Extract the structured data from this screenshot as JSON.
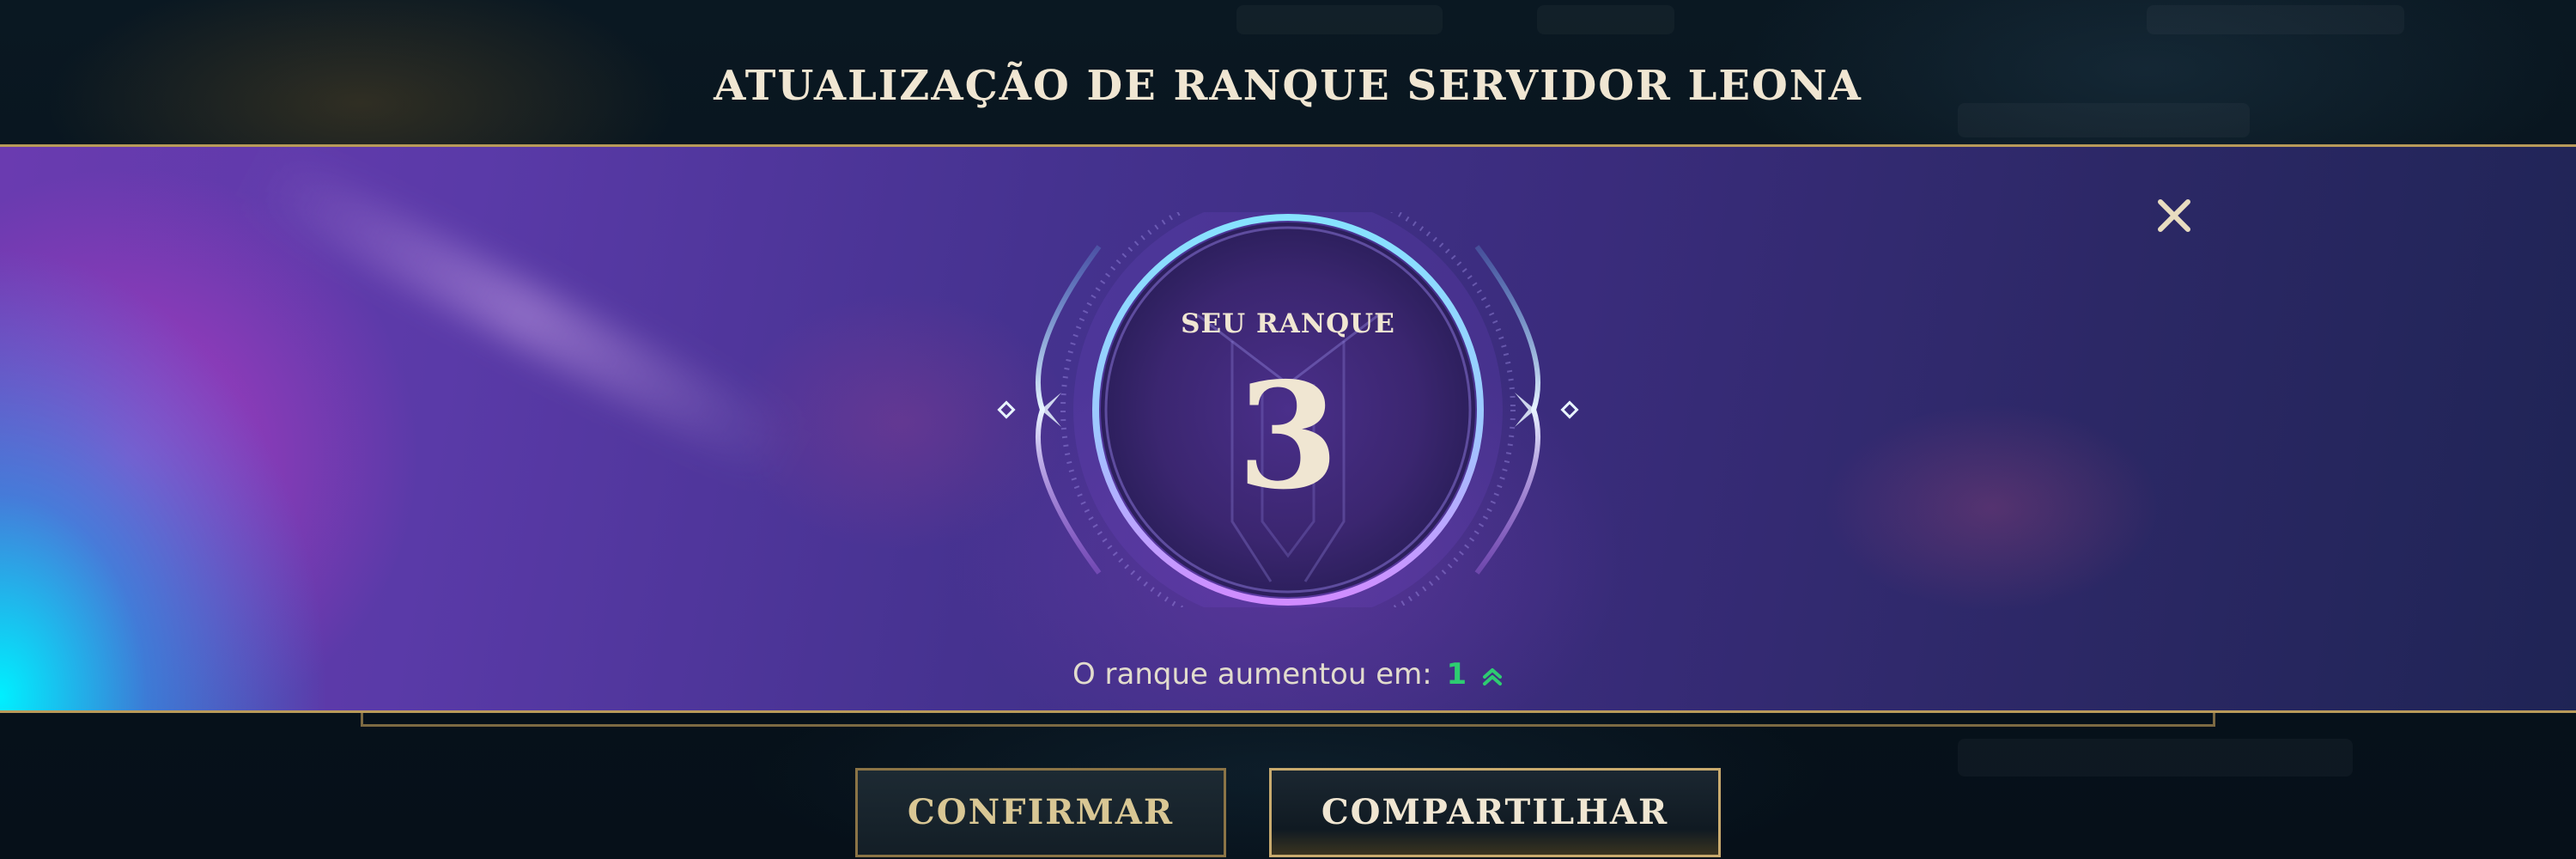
{
  "header": {
    "title": "ATUALIZAÇÃO DE RANQUE SERVIDOR LEONA"
  },
  "rank_card": {
    "label": "SEU RANQUE",
    "rank": "3",
    "change_text": "O ranque aumentou em:",
    "change_value": "1",
    "change_icon": "chevron-up-icon",
    "change_color": "#2ecc71"
  },
  "dialog": {
    "close_icon": "close-icon"
  },
  "actions": {
    "confirm_label": "CONFIRMAR",
    "share_label": "COMPARTILHAR"
  },
  "colors": {
    "accent_gold": "#c8aa6e",
    "text_light": "#f0e6d2",
    "ring_cyan": "#7fd8ff",
    "ring_purple": "#c77dff"
  }
}
